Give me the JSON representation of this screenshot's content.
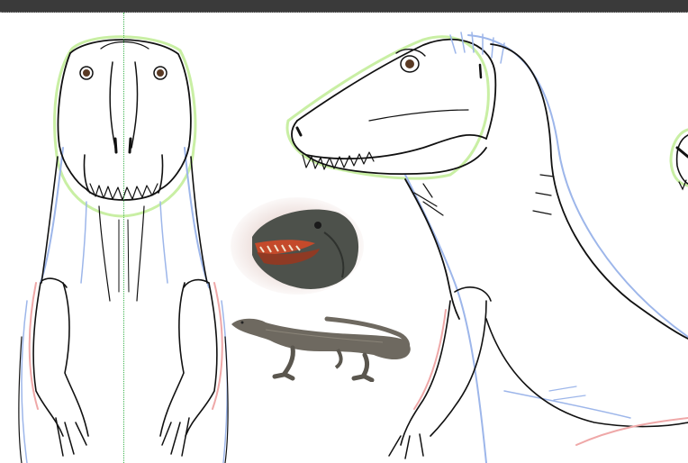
{
  "app": {
    "window_title": "",
    "accent_color": "#3a3a3a"
  },
  "canvas": {
    "background": "#ffffff",
    "guide_color": "#3fb34f",
    "layers": [
      {
        "name": "sketch-lines",
        "color": "#111111"
      },
      {
        "name": "blue-guides",
        "color": "#9db6ea"
      },
      {
        "name": "green-guides",
        "color": "#c9efa4"
      },
      {
        "name": "red-guides",
        "color": "#efa8a8"
      }
    ]
  },
  "references": [
    {
      "name": "trex-head-reference",
      "icon": "dinosaur-head-photo"
    },
    {
      "name": "komodo-dragon-reference",
      "icon": "lizard-photo"
    }
  ]
}
